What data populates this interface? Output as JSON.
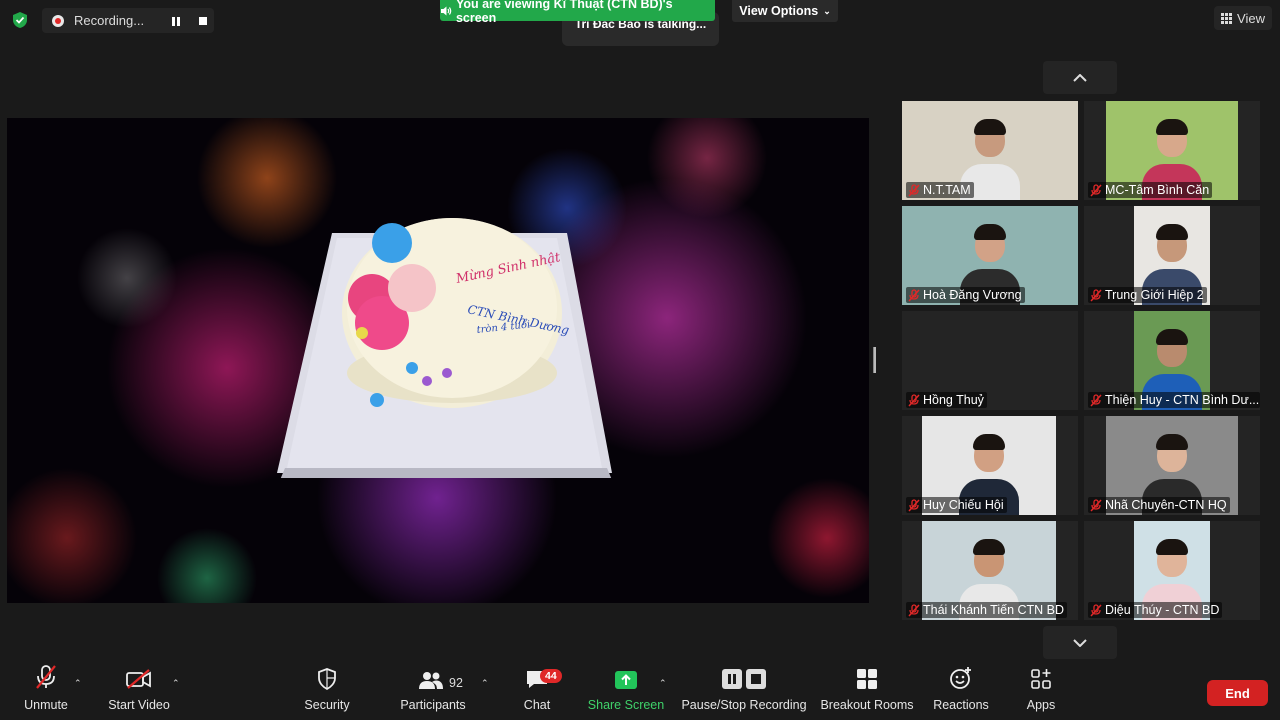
{
  "top_bar": {
    "recording_label": "Recording...",
    "viewing_banner": "You are viewing Kĩ Thuật (CTN BD)'s screen",
    "talking_indicator": "Trí Đắc Bảo is talking...",
    "view_options_label": "View Options",
    "view_label": "View"
  },
  "shared_screen": {
    "cake_text_line1": "Mừng Sinh nhật",
    "cake_text_line2": "CTN Bình Dương",
    "cake_text_line3": "tròn 4 tuổi"
  },
  "participants": [
    {
      "name": "N.T.TAM"
    },
    {
      "name": "MC-Tâm Bình Căn"
    },
    {
      "name": "Hoà Đăng Vương"
    },
    {
      "name": "Trung Giới Hiệp 2"
    },
    {
      "name": "Hồng Thuỷ"
    },
    {
      "name": "Thiện Huy - CTN Bình Dư..."
    },
    {
      "name": "Huy Chiếu Hội"
    },
    {
      "name": "Nhã Chuyên-CTN HQ"
    },
    {
      "name": "Thái Khánh Tiến CTN BD"
    },
    {
      "name": "Diệu Thúy - CTN BD"
    }
  ],
  "toolbar": {
    "unmute": "Unmute",
    "start_video": "Start Video",
    "security": "Security",
    "participants": "Participants",
    "participants_count": "92",
    "chat": "Chat",
    "chat_badge": "44",
    "share_screen": "Share Screen",
    "pause_stop_recording": "Pause/Stop Recording",
    "breakout_rooms": "Breakout Rooms",
    "reactions": "Reactions",
    "apps": "Apps",
    "end": "End"
  },
  "colors": {
    "accent_green": "#22a84a",
    "end_red": "#d32222",
    "share_green": "#3fd16a",
    "muted_red": "#e02828"
  }
}
